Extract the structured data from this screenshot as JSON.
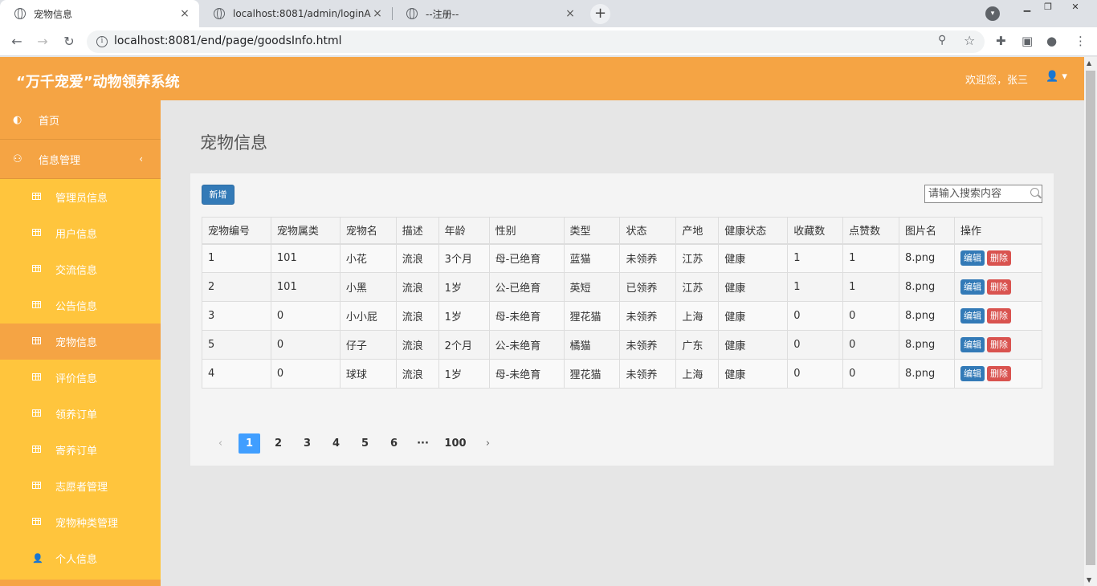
{
  "browser": {
    "tabs": [
      {
        "title": "宠物信息",
        "close": "×"
      },
      {
        "title": "localhost:8081/admin/loginAd",
        "close": "×"
      },
      {
        "title": "--注册--",
        "close": "×"
      }
    ],
    "new_tab": "+",
    "url": "localhost:8081/end/page/goodsInfo.html"
  },
  "header": {
    "title": "“万千宠爱”动物领养系统",
    "welcome": "欢迎您，张三",
    "user_icon": "user-icon"
  },
  "sidebar": {
    "home": "首页",
    "group": "信息管理",
    "items": [
      {
        "label": "管理员信息",
        "icon": "table-icon"
      },
      {
        "label": "用户信息",
        "icon": "table-icon"
      },
      {
        "label": "交流信息",
        "icon": "table-icon"
      },
      {
        "label": "公告信息",
        "icon": "table-icon"
      },
      {
        "label": "宠物信息",
        "icon": "table-icon",
        "active": true
      },
      {
        "label": "评价信息",
        "icon": "table-icon"
      },
      {
        "label": "领养订单",
        "icon": "table-icon"
      },
      {
        "label": "寄养订单",
        "icon": "table-icon"
      },
      {
        "label": "志愿者管理",
        "icon": "table-icon"
      },
      {
        "label": "宠物种类管理",
        "icon": "table-icon"
      },
      {
        "label": "个人信息",
        "icon": "user-icon"
      }
    ]
  },
  "main": {
    "page_title": "宠物信息",
    "add_label": "新增",
    "search_placeholder": "请输入搜索内容",
    "columns": [
      "宠物编号",
      "宠物属类",
      "宠物名",
      "描述",
      "年龄",
      "性别",
      "类型",
      "状态",
      "产地",
      "健康状态",
      "收藏数",
      "点赞数",
      "图片名",
      "操作"
    ],
    "rows": [
      [
        "1",
        "101",
        "小花",
        "流浪",
        "3个月",
        "母-已绝育",
        "蓝猫",
        "未领养",
        "江苏",
        "健康",
        "1",
        "1",
        "8.png"
      ],
      [
        "2",
        "101",
        "小黑",
        "流浪",
        "1岁",
        "公-已绝育",
        "英短",
        "已领养",
        "江苏",
        "健康",
        "1",
        "1",
        "8.png"
      ],
      [
        "3",
        "0",
        "小小屁",
        "流浪",
        "1岁",
        "母-未绝育",
        "狸花猫",
        "未领养",
        "上海",
        "健康",
        "0",
        "0",
        "8.png"
      ],
      [
        "5",
        "0",
        "仔子",
        "流浪",
        "2个月",
        "公-未绝育",
        "橘猫",
        "未领养",
        "广东",
        "健康",
        "0",
        "0",
        "8.png"
      ],
      [
        "4",
        "0",
        "球球",
        "流浪",
        "1岁",
        "母-未绝育",
        "狸花猫",
        "未领养",
        "上海",
        "健康",
        "0",
        "0",
        "8.png"
      ]
    ],
    "edit_label": "编辑",
    "delete_label": "删除",
    "pagination": {
      "prev": "‹",
      "pages": [
        "1",
        "2",
        "3",
        "4",
        "5",
        "6",
        "···",
        "100"
      ],
      "current": "1",
      "next": "›"
    }
  },
  "colors": {
    "header": "#f5a444",
    "sidebar": "#ffc53d",
    "primary": "#337ab7",
    "danger": "#d9534f",
    "page_active": "#409eff"
  }
}
